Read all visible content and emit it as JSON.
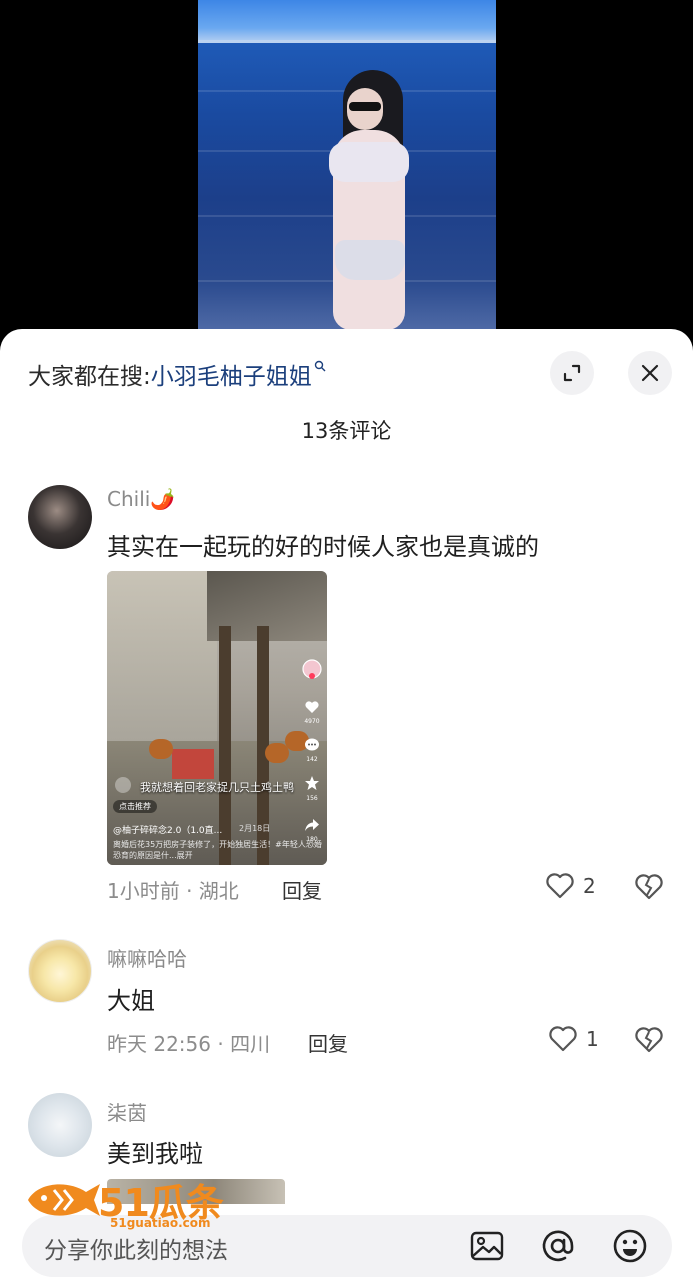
{
  "search": {
    "prefix": "大家都在搜:",
    "term": "小羽毛柚子姐姐"
  },
  "header": {
    "count_label": "13条评论"
  },
  "comments": [
    {
      "username": "Chili🌶️",
      "text": "其实在一起玩的好的时候人家也是真诚的",
      "meta": "1小时前 · 湖北",
      "reply_label": "回复",
      "likes": "2",
      "image": {
        "caption": "我就想着回老家捉几只土鸡土鸭",
        "pill": "点击推荐",
        "author": "@柚子碎碎念2.0（1.0直...",
        "date": "2月18日",
        "desc": "离婚后花35万把房子装修了，开始独居生活！#年轻人恐婚恐育的原因是什...展开",
        "side_counts": [
          "4970",
          "142",
          "156",
          "180"
        ]
      }
    },
    {
      "username": "嘛嘛哈哈",
      "text": "大姐",
      "meta": "昨天 22:56 · 四川",
      "reply_label": "回复",
      "likes": "1"
    },
    {
      "username": "柒茵",
      "text": "美到我啦"
    }
  ],
  "composer": {
    "placeholder": "分享你此刻的想法"
  },
  "watermark": {
    "logo_text": "51瓜条",
    "domain": "51guatiao.com"
  },
  "colors": {
    "link": "#1b3f7c",
    "muted": "#8a8a8a",
    "accent_orange": "#f08a1e"
  },
  "icons": [
    "search-mini-icon",
    "expand-icon",
    "close-icon",
    "heart-icon",
    "broken-heart-icon",
    "image-icon",
    "at-icon",
    "emoji-icon"
  ]
}
